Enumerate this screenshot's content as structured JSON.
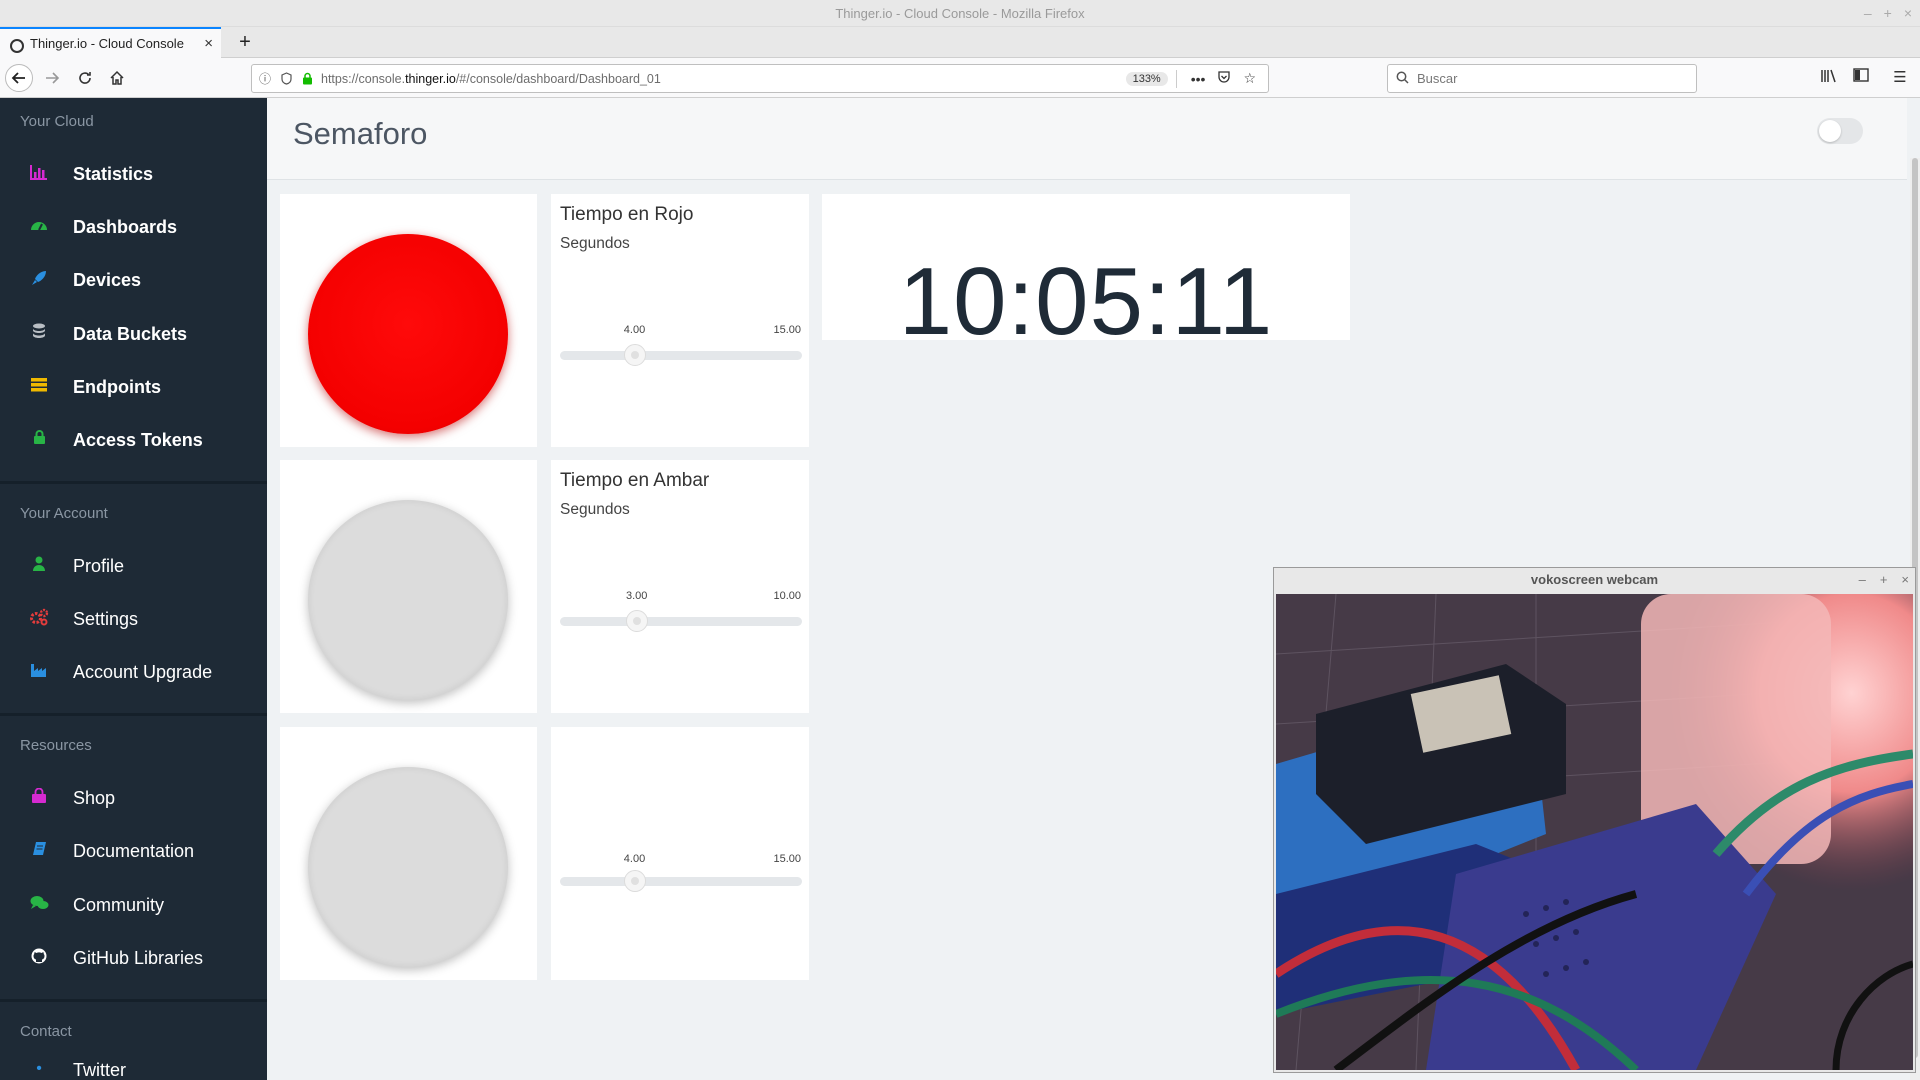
{
  "window": {
    "title": "Thinger.io - Cloud Console - Mozilla Firefox",
    "controls": [
      "–",
      "+",
      "×"
    ]
  },
  "tab": {
    "title": "Thinger.io - Cloud Console",
    "close": "×",
    "new_tab": "+"
  },
  "nav": {
    "url_prefix": "https://console.",
    "url_host": "thinger.io",
    "url_path": "/#/console/dashboard/Dashboard_01",
    "zoom": "133%",
    "search_placeholder": "Buscar"
  },
  "sidebar": {
    "your_cloud": {
      "header": "Your Cloud",
      "items": [
        {
          "label": "Statistics",
          "icon": "bar-chart-icon",
          "color": "#d62ad1"
        },
        {
          "label": "Dashboards",
          "icon": "dashboard-gauge-icon",
          "color": "#28b446"
        },
        {
          "label": "Devices",
          "icon": "rocket-icon",
          "color": "#2a8fe0"
        },
        {
          "label": "Data Buckets",
          "icon": "database-icon",
          "color": "#b9bec4"
        },
        {
          "label": "Endpoints",
          "icon": "server-icon",
          "color": "#f0b900"
        },
        {
          "label": "Access Tokens",
          "icon": "lock-icon",
          "color": "#28b446"
        }
      ]
    },
    "your_account": {
      "header": "Your Account",
      "items": [
        {
          "label": "Profile",
          "icon": "user-icon",
          "color": "#28b446"
        },
        {
          "label": "Settings",
          "icon": "gears-icon",
          "color": "#e23c3c"
        },
        {
          "label": "Account Upgrade",
          "icon": "industry-icon",
          "color": "#2a8fe0"
        }
      ]
    },
    "resources": {
      "header": "Resources",
      "items": [
        {
          "label": "Shop",
          "icon": "shopping-bag-icon",
          "color": "#d62ad1"
        },
        {
          "label": "Documentation",
          "icon": "book-icon",
          "color": "#2a8fe0"
        },
        {
          "label": "Community",
          "icon": "comments-icon",
          "color": "#28b446"
        },
        {
          "label": "GitHub Libraries",
          "icon": "github-icon",
          "color": "#ffffff"
        }
      ]
    },
    "contact": {
      "header": "Contact",
      "partial_item": "Twitter"
    }
  },
  "dashboard": {
    "title": "Semaforo",
    "leds": [
      {
        "state": "on",
        "color": "#ff0000"
      },
      {
        "state": "off",
        "color": "#dcdcdc"
      },
      {
        "state": "off",
        "color": "#dcdcdc"
      }
    ],
    "sliders": [
      {
        "title": "Tiempo en Rojo",
        "subtitle": "Segundos",
        "value": "4.00",
        "max": "15.00",
        "fraction": 0.29
      },
      {
        "title": "Tiempo en Ambar",
        "subtitle": "Segundos",
        "value": "3.00",
        "max": "10.00",
        "fraction": 0.3
      },
      {
        "title": "",
        "subtitle": "",
        "value": "4.00",
        "max": "15.00",
        "fraction": 0.29
      }
    ],
    "clock": "10:05:11"
  },
  "webcam": {
    "title": "vokoscreen webcam",
    "controls": [
      "–",
      "+",
      "×"
    ]
  }
}
